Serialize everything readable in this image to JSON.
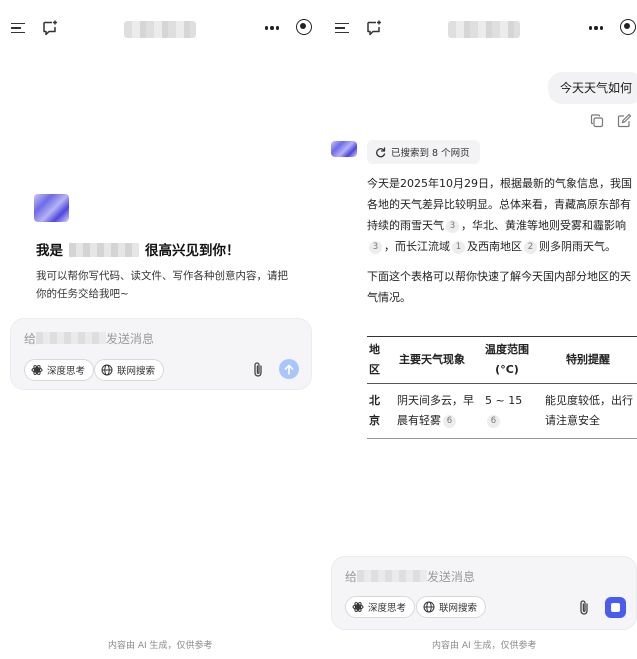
{
  "left": {
    "welcome": {
      "greeting_prefix": "我是",
      "greeting_suffix": "很高兴见到你！",
      "description": "我可以帮你写代码、读文件、写作各种创意内容，请把你的任务交给我吧~"
    },
    "input": {
      "placeholder_prefix": "给",
      "placeholder_suffix": "发送消息",
      "deep_think_label": "深度思考",
      "web_search_label": "联网搜索"
    },
    "footer": "内容由 AI 生成，仅供参考"
  },
  "right": {
    "user_message": "今天天气如何",
    "search_status": "已搜索到 8 个网页",
    "answer": {
      "p1_a": "今天是2025年10月29日，根据最新的气象信息，我国各地的天气差异比较明显。总体来看，青藏高原东部有持续的雨雪天气",
      "cite1": "3",
      "p1_b": "，华北、黄淮等地则受雾和霾影响",
      "cite2": "3",
      "p1_c": "，而长江流域",
      "cite3": "1",
      "p1_d": "及西南地区",
      "cite4": "2",
      "p1_e": "则多阴雨天气。",
      "p2": "下面这个表格可以帮你快速了解今天国内部分地区的天气情况。"
    },
    "table": {
      "headers": [
        "地区",
        "主要天气现象",
        "温度范围(°C)",
        "特别提醒"
      ],
      "rows": [
        {
          "region": "北京",
          "weather": "阴天间多云，早晨有轻雾",
          "weather_cite": "6",
          "temp": "5 ~ 15",
          "temp_cite": "6",
          "tip": "能见度较低，出行请注意安全"
        }
      ]
    },
    "input": {
      "placeholder_prefix": "给",
      "placeholder_suffix": "发送消息",
      "deep_think_label": "深度思考",
      "web_search_label": "联网搜索"
    },
    "footer": "内容由 AI 生成，仅供参考"
  },
  "colors": {
    "accent": "#4a5cf0",
    "send_disabled": "#a9c5fb",
    "input_bg": "#f5f5f7"
  },
  "icons": [
    "menu-icon",
    "new-chat-icon",
    "more-icon",
    "target-icon",
    "deep-think-icon",
    "globe-icon",
    "paperclip-icon",
    "send-icon",
    "stop-icon",
    "copy-icon",
    "edit-icon",
    "search-refresh-icon"
  ]
}
